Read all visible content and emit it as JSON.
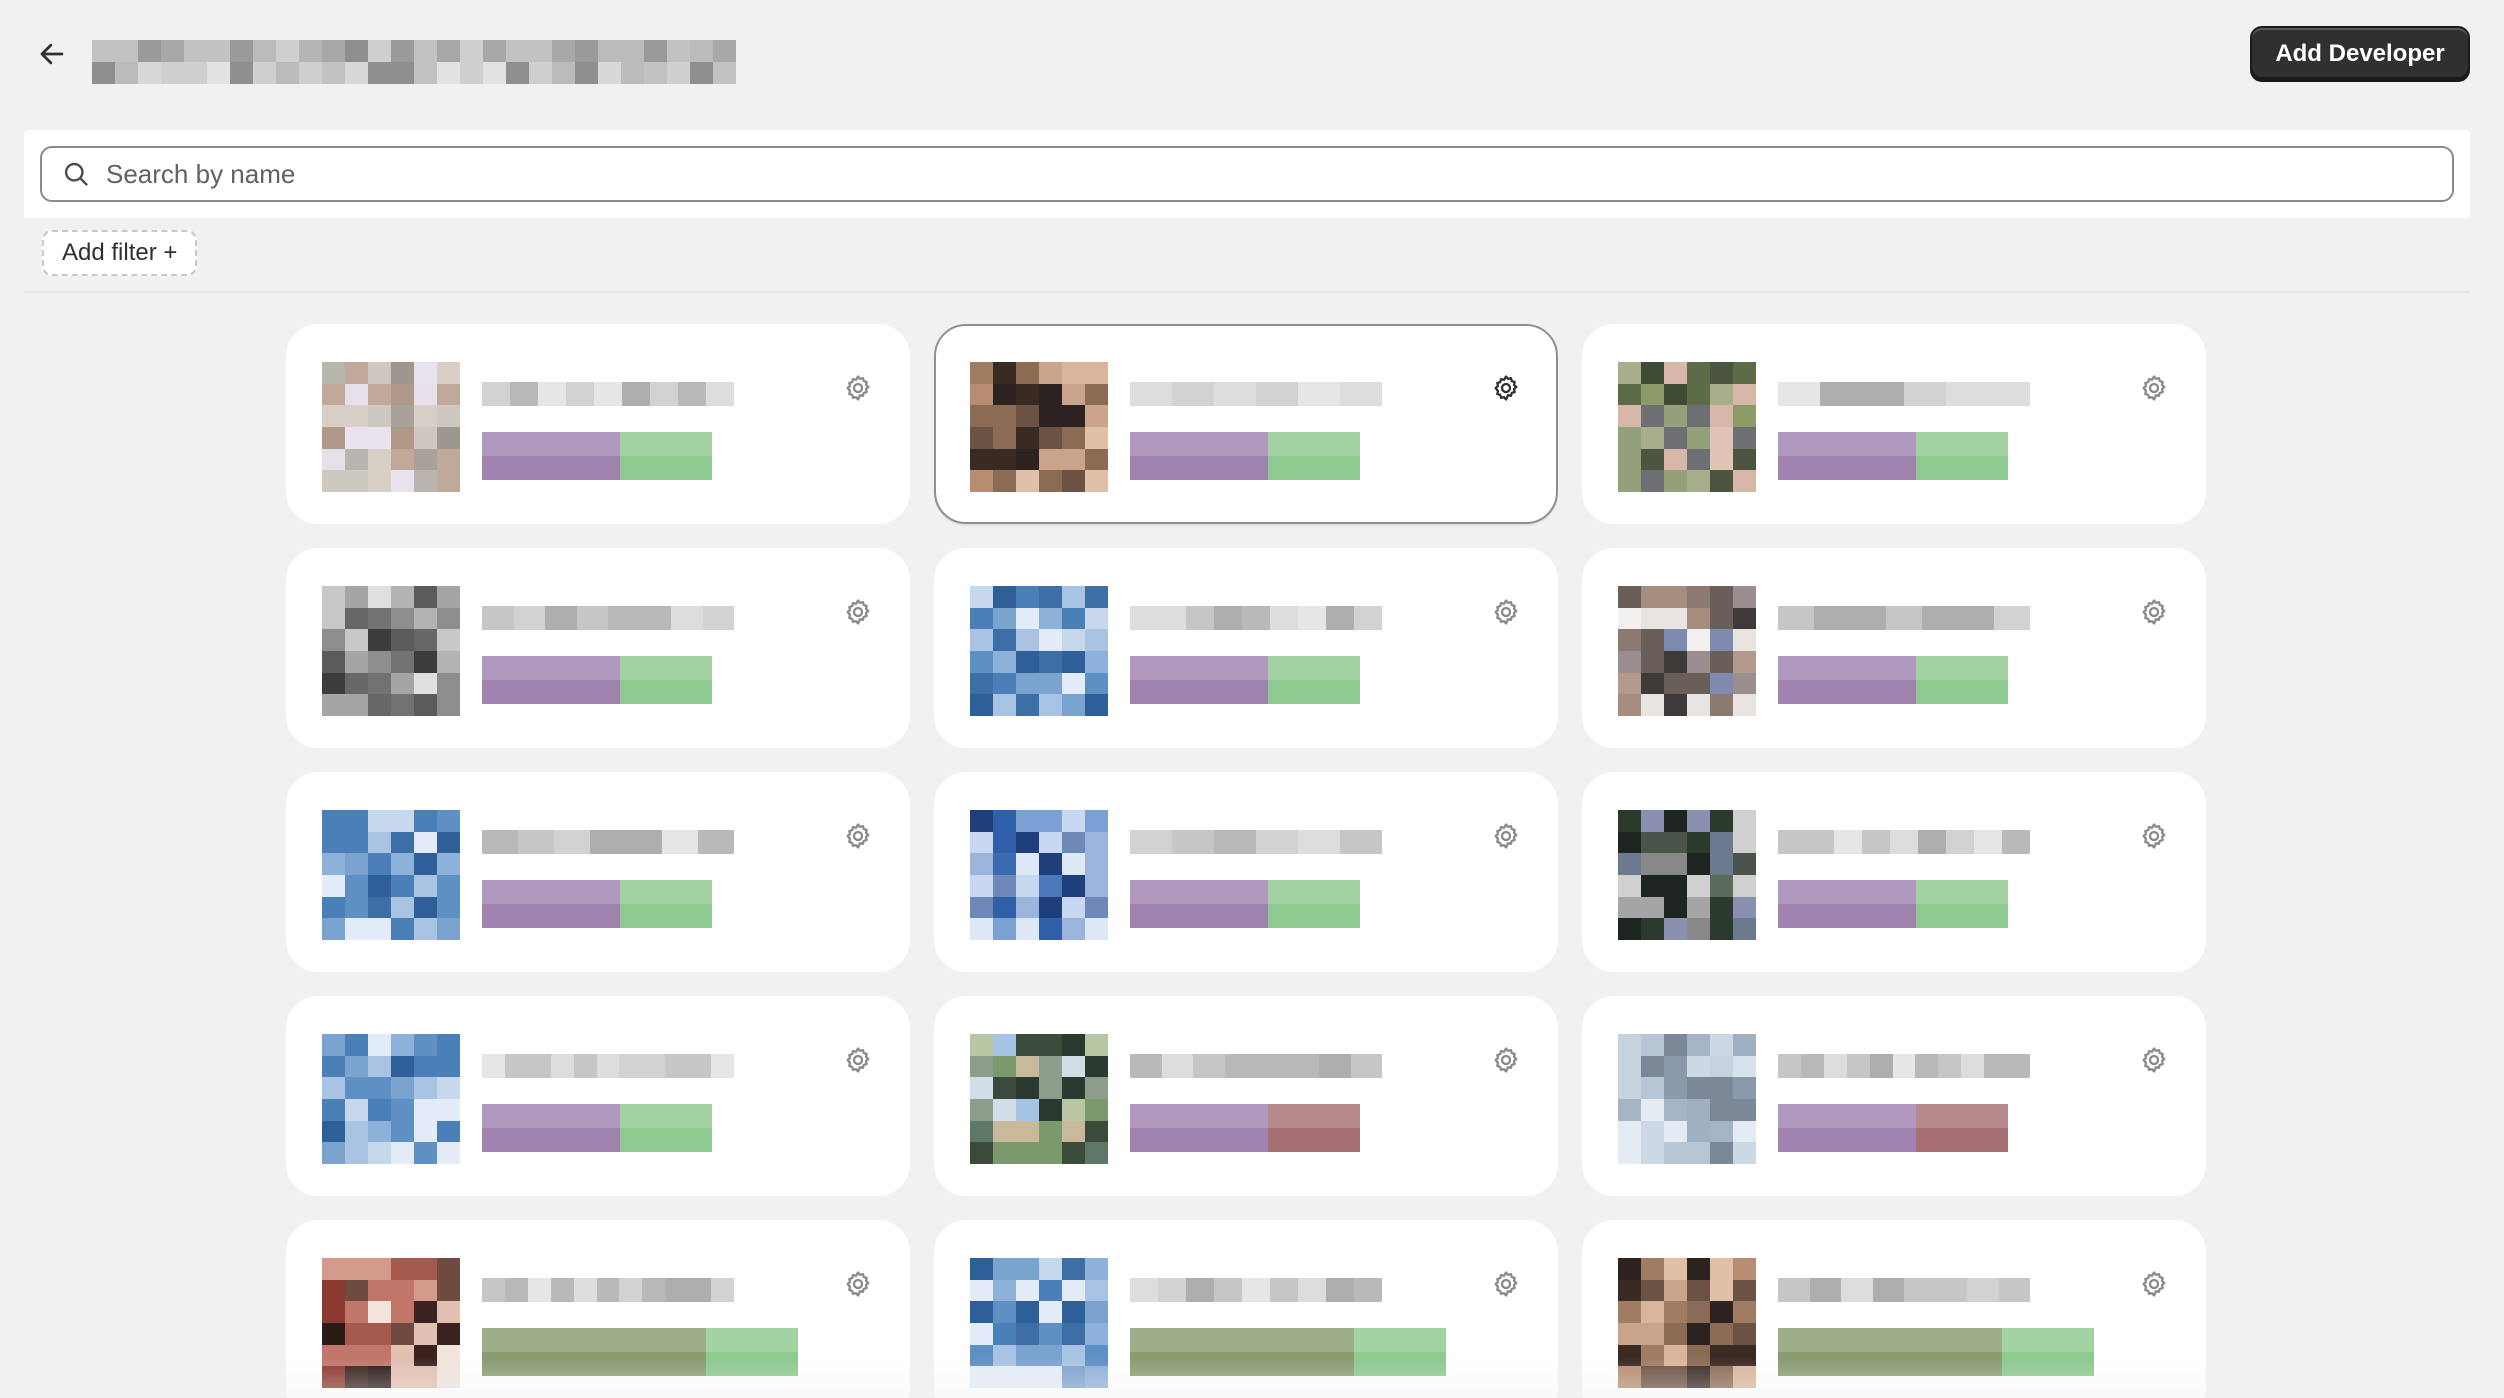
{
  "header": {
    "back_label": "Back",
    "primary_button_label": "Add Developer"
  },
  "search": {
    "placeholder": "Search by name",
    "value": ""
  },
  "filters": {
    "add_filter_label": "Add filter +"
  },
  "colors": {
    "tag_purple": "#a082b0",
    "tag_green": "#8ec98f",
    "tag_red": "#a56f72",
    "tag_olive": "#8a9d71"
  },
  "cards": [
    {
      "selected": false,
      "palette": "warm-gray",
      "tags": [
        "purple",
        "green"
      ]
    },
    {
      "selected": true,
      "palette": "warm",
      "tags": [
        "purple",
        "green"
      ]
    },
    {
      "selected": false,
      "palette": "green-olive",
      "tags": [
        "purple",
        "green"
      ]
    },
    {
      "selected": false,
      "palette": "dark-gray",
      "tags": [
        "purple",
        "green"
      ]
    },
    {
      "selected": false,
      "palette": "blue",
      "tags": [
        "purple",
        "green"
      ]
    },
    {
      "selected": false,
      "palette": "portrait-slim",
      "tags": [
        "purple",
        "green"
      ]
    },
    {
      "selected": false,
      "palette": "blue",
      "tags": [
        "purple",
        "green"
      ]
    },
    {
      "selected": false,
      "palette": "blue-dark",
      "tags": [
        "purple",
        "green"
      ]
    },
    {
      "selected": false,
      "palette": "dark-green",
      "tags": [
        "purple",
        "green"
      ]
    },
    {
      "selected": false,
      "palette": "blue",
      "tags": [
        "purple",
        "green"
      ]
    },
    {
      "selected": false,
      "palette": "sky-olive",
      "tags": [
        "purple",
        "red"
      ]
    },
    {
      "selected": false,
      "palette": "pale-blue",
      "tags": [
        "purple",
        "red"
      ]
    },
    {
      "selected": false,
      "palette": "red-warm",
      "tags": [
        "olive",
        "green"
      ]
    },
    {
      "selected": false,
      "palette": "blue",
      "tags": [
        "olive",
        "green"
      ]
    },
    {
      "selected": false,
      "palette": "warm",
      "tags": [
        "olive",
        "green"
      ]
    }
  ],
  "icons": {
    "back": "arrow-left-icon",
    "search": "magnifier-icon",
    "settings": "gear-icon"
  }
}
